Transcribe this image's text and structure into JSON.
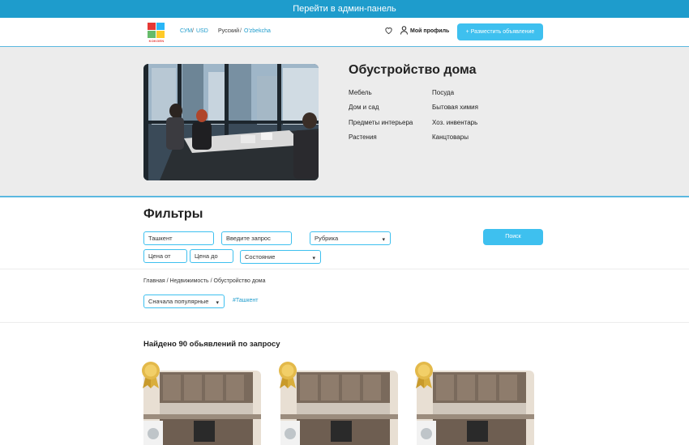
{
  "admin_bar": {
    "label": "Перейти в админ-панель"
  },
  "header": {
    "logo_text": "KOKGEN",
    "currency": {
      "first": "СУМ",
      "separator": "/",
      "second": "USD"
    },
    "language": {
      "first": "Русский",
      "separator": "/",
      "second": "O'zbekcha"
    },
    "profile_label": "Мой профиль",
    "post_button": "+ Разместить объявление"
  },
  "hero": {
    "title": "Обустройство дома",
    "categories": [
      "Мебель",
      "Посуда",
      "Дом и сад",
      "Бытовая химия",
      "Предметы интерьера",
      "Хоз. инвентарь",
      "Растения",
      "Канцтовары"
    ]
  },
  "filters": {
    "title": "Фильтры",
    "city_value": "Ташкент",
    "query_placeholder": "Введите запрос",
    "rubric_value": "Рубрика",
    "price_from_placeholder": "Цена от",
    "price_to_placeholder": "Цена до",
    "condition_value": "Состояние",
    "search_button": "Поиск"
  },
  "breadcrumb": {
    "items": [
      "Главная",
      "Недвижимость",
      "Обустройство дома"
    ],
    "separator": " / "
  },
  "sort": {
    "value": "Сначала популярные"
  },
  "tag": "#Ташкент",
  "results": {
    "found_text": "Найдено 90 обьявлений по запросу"
  },
  "colors": {
    "accent": "#3ec0ef",
    "admin_bar": "#1e9ccc",
    "hero_bg": "#ececec"
  }
}
